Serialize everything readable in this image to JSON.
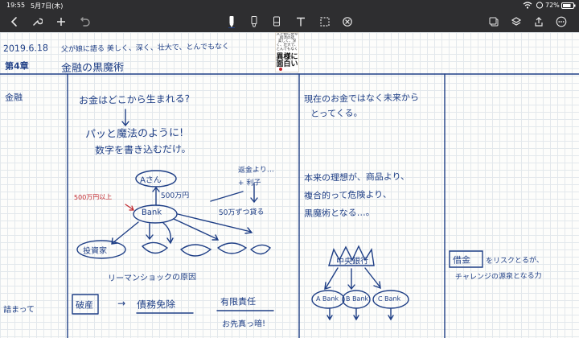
{
  "status": {
    "time": "19:55",
    "date": "5月7日(木)",
    "battery": "72%"
  },
  "toolbar": {
    "left": [
      "back-icon",
      "wrench-icon",
      "plus-icon",
      "undo-icon"
    ],
    "tools": [
      "pen-icon",
      "highlighter-icon",
      "eraser-icon",
      "text-icon",
      "lasso-icon",
      "tape-icon"
    ],
    "right": [
      "share-icon",
      "layers-icon",
      "upload-icon",
      "more-icon"
    ]
  },
  "colors": {
    "ink": "#1f3f86",
    "accent": "#c0262d",
    "chrome": "#2e2e30"
  },
  "header": {
    "date": "2019.6.18",
    "subtitle": "父が娘に語る 美しく、深く、壮大で、とんでもなく",
    "chapter": "第4章",
    "chapter_title": "金融の黒魔術"
  },
  "book_cover": {
    "line1": "父が娘に語る",
    "line2": "経済の話",
    "line3": "美しく、深く、壮大で、とんでもなく",
    "big1": "異様に",
    "big2": "面白い"
  },
  "labels": {
    "kinyu": "金融",
    "tsumari": "詰まって"
  },
  "col2": {
    "q": "お金はどこから生まれる?",
    "line2": "パッと魔法のように!",
    "line3": "数字を書き込むだけ。",
    "a_san": "Aさん",
    "loan": "500万円",
    "red_note": "500万円以上",
    "bank": "Bank",
    "interest": "返金より…",
    "plus_interest": "+ 利子",
    "fiftyman": "50万ずつ貸る",
    "company": "投資家",
    "lehman": "リーマンショックの原因",
    "hasan": "破産",
    "arrow": "→",
    "saimu": "債務免除",
    "yugen": "有限責任",
    "omoi": "お先真っ暗!"
  },
  "col3": {
    "line1": "現在のお金ではなく未来から",
    "line2": "とってくる。",
    "p1": "本来の理想が、商品より、",
    "p2": "複合的って危険より、",
    "p3": "黒魔術となる…。",
    "chuo": "中央銀行",
    "banks": [
      "A Bank",
      "B Bank",
      "C Bank"
    ]
  },
  "col4": {
    "shakkin": "借金",
    "line1": "をリスクとるが、",
    "line2": "チャレンジの源泉となる力"
  }
}
